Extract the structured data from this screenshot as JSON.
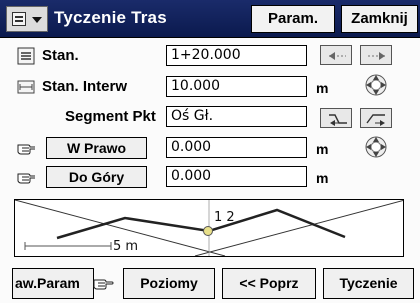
{
  "window": {
    "title": "Tyczenie Tras",
    "param_label": "Param.",
    "close_label": "Zamknij"
  },
  "form": {
    "station": {
      "label": "Stan.",
      "value": "1+20.000"
    },
    "interval": {
      "label": "Stan. Interw",
      "value": "10.000",
      "unit": "m"
    },
    "segment": {
      "label": "Segment Pkt",
      "value": "Oś Gł."
    },
    "right": {
      "label": "W Prawo",
      "value": "0.000",
      "unit": "m"
    },
    "up": {
      "label": "Do Góry",
      "value": "0.000",
      "unit": "m"
    }
  },
  "graphic": {
    "scale_label": "5 m",
    "point_label": "1 2"
  },
  "bottom": {
    "params_label": "aw.Param",
    "levels_label": "Poziomy",
    "prev_label": "<< Poprz",
    "stake_label": "Tyczenie"
  },
  "colors": {
    "title_bg": "#0b1a4e",
    "point": "#e8e08a"
  }
}
